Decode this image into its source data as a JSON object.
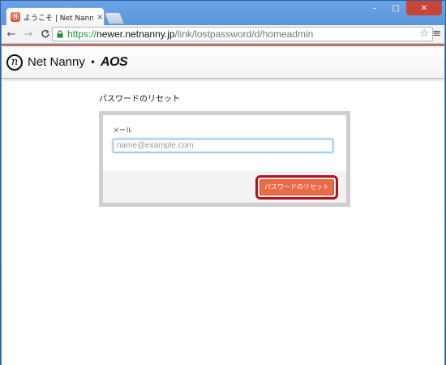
{
  "browser": {
    "tab": {
      "favicon": "Ⓝ",
      "title": "ようこそ | Net Nanny イン",
      "close": "×"
    },
    "window_controls": {
      "minimize": "–",
      "maximize": "□",
      "close": "✕"
    },
    "nav": {
      "back": "←",
      "forward": "→",
      "reload": "C"
    },
    "address": {
      "scheme": "https://",
      "host": "newer.netnanny.jp",
      "path": "/link/lostpassword/d/homeadmin"
    },
    "star": "☆",
    "menu": "≡"
  },
  "site": {
    "logo_mark": "n",
    "logo_text": "Net Nanny",
    "logo_separator": "•",
    "logo_partner": "AOS"
  },
  "form": {
    "title": "パスワードのリセット",
    "email_label": "メール",
    "email_placeholder": "name@example.com",
    "email_value": "",
    "submit_label": "パスワードのリセット"
  },
  "colors": {
    "accent": "#ec6a45",
    "highlight_border": "#b3121d",
    "input_focus": "#6eb0e8"
  }
}
